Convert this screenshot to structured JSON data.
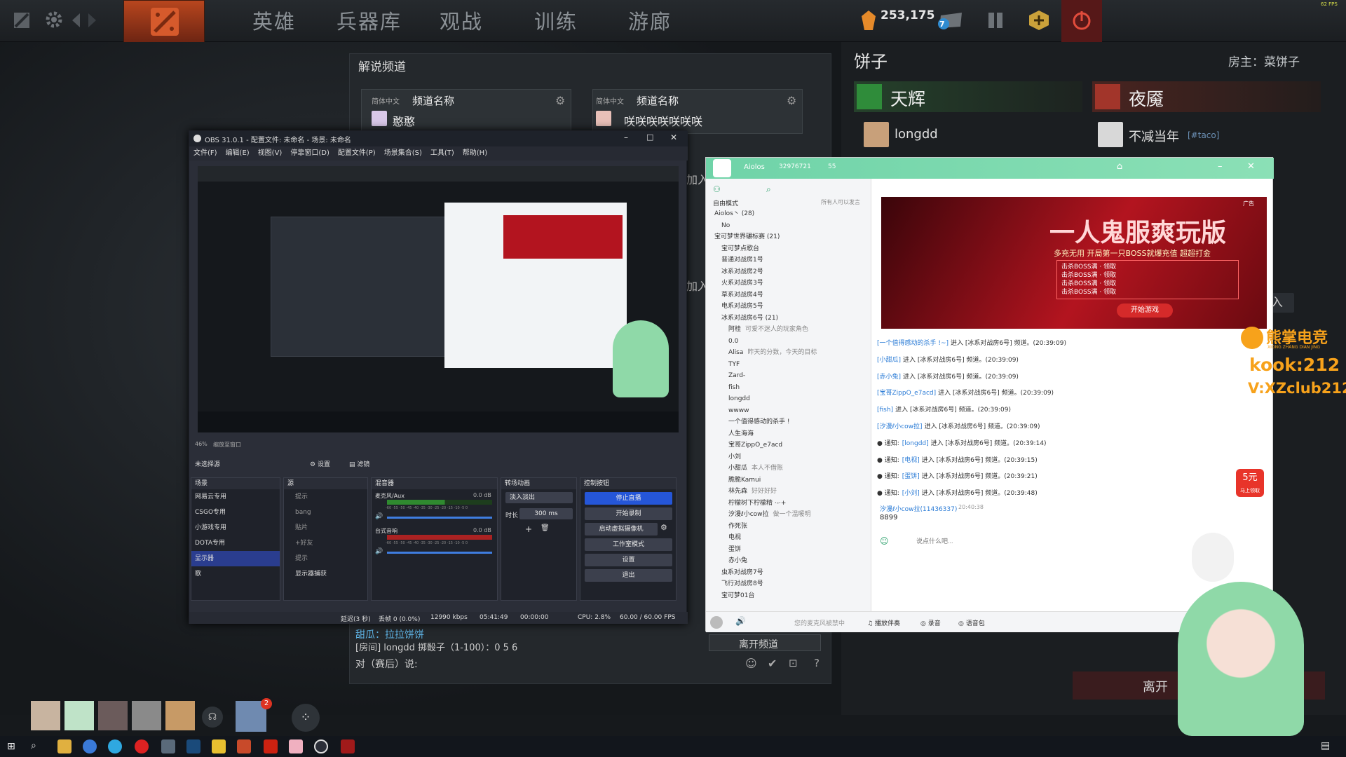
{
  "fps": "62 FPS",
  "dota": {
    "tabs": [
      "英雄",
      "兵器库",
      "观战",
      "训练",
      "游廊"
    ],
    "currency": "253,175",
    "notif_count": "7",
    "friend_badge": "2"
  },
  "commentary": {
    "title": "解说频道",
    "cards": [
      {
        "lang": "简体中文",
        "label": "频道名称",
        "user": "憨憨"
      },
      {
        "lang": "简体中文",
        "label": "频道名称",
        "user": "咲咲咲咲咲咲咲"
      }
    ],
    "join_labels": [
      "加入",
      "加入"
    ],
    "chat_1": "甜瓜：拉拉饼饼",
    "chat_2": "[房间] longdd 掷骰子（1-100）：0 5 6",
    "chat_prompt": "对（赛后）说:",
    "leave": "离开频道",
    "leave_right": "离开"
  },
  "lobby": {
    "name": "饼子",
    "host": "房主：菜饼子",
    "radiant": "天辉",
    "dire": "夜魇",
    "radiant_player": "longdd",
    "dire_player": "不减当年",
    "dire_tag": "[#taco]",
    "join_btn": "加入"
  },
  "obs": {
    "title": "OBS 31.0.1 - 配置文件: 未命名 - 场景: 未命名",
    "menu": [
      "文件(F)",
      "编辑(E)",
      "视图(V)",
      "停靠窗口(D)",
      "配置文件(P)",
      "场景集合(S)",
      "工具(T)",
      "帮助(H)"
    ],
    "zoom": "46%",
    "zoom_mode": "缩放至窗口",
    "no_source": "未选择源",
    "props_btn": "设置",
    "filters_btn": "滤镜",
    "docks": {
      "scenes": "场景",
      "sources": "源",
      "mixer": "混音器",
      "transitions": "转场动画",
      "controls": "控制按钮"
    },
    "scenes": [
      "网易云专用",
      "CSGO专用",
      "小游戏专用",
      "DOTA专用",
      "显示器",
      "歌"
    ],
    "sources": [
      "提示",
      "bang",
      "贴片",
      "+好友",
      "提示",
      "显示器捕获"
    ],
    "mixer": [
      {
        "name": "麦克风/Aux",
        "db": "0.0 dB"
      },
      {
        "name": "台式音响",
        "db": "0.0 dB"
      }
    ],
    "meter_scale": "-60 -55 -50 -45 -40 -35 -30 -25 -20 -15 -10 -5 0",
    "transition": "淡入淡出",
    "duration_label": "时长",
    "duration": "300 ms",
    "controls": [
      "停止直播",
      "开始录制",
      "启动虚拟摄像机",
      "工作室模式",
      "设置",
      "退出"
    ],
    "status": {
      "dropped": "延迟(3 秒)",
      "frames": "丢帧 0 (0.0%)",
      "bitrate": "12990 kbps",
      "live_time": "05:41:49",
      "rec_time": "00:00:00",
      "cpu": "CPU: 2.8%",
      "fps": "60.00 / 60.00 FPS"
    }
  },
  "kook": {
    "server": "Aiolos",
    "id": "32976721",
    "members": "55",
    "mode": "自由模式",
    "mode_right": "所有人可以发言",
    "tree": [
      {
        "t": "Aiolos丶 (28)",
        "lvl": 0
      },
      {
        "t": "No",
        "lvl": 1
      },
      {
        "t": "宝可梦世界碾标赛 (21)",
        "lvl": 0
      },
      {
        "t": "宝可梦点歌台",
        "lvl": 1
      },
      {
        "t": "普通对战房1号",
        "lvl": 1
      },
      {
        "t": "冰系对战房2号",
        "lvl": 1
      },
      {
        "t": "火系对战房3号",
        "lvl": 1
      },
      {
        "t": "草系对战房4号",
        "lvl": 1
      },
      {
        "t": "电系对战房5号",
        "lvl": 1
      },
      {
        "t": "冰系对战房6号 (21)",
        "lvl": 1
      },
      {
        "t": "阿桂",
        "lvl": 2,
        "note": "可爱不迷人的玩家角色"
      },
      {
        "t": "0.0",
        "lvl": 2
      },
      {
        "t": "Alisa",
        "lvl": 2,
        "note": "昨天的分数，今天的目标"
      },
      {
        "t": "TYF",
        "lvl": 2
      },
      {
        "t": "Zard-",
        "lvl": 2
      },
      {
        "t": "fish",
        "lvl": 2
      },
      {
        "t": "longdd",
        "lvl": 2
      },
      {
        "t": "wwww",
        "lvl": 2
      },
      {
        "t": "一个值得感动的杀手 !",
        "lvl": 2
      },
      {
        "t": "人生海海",
        "lvl": 2
      },
      {
        "t": "宝哥ZippO_e7acd",
        "lvl": 2
      },
      {
        "t": "小刘",
        "lvl": 2
      },
      {
        "t": "小甜瓜",
        "lvl": 2,
        "note": "本人不借账"
      },
      {
        "t": "脆脆Kamui",
        "lvl": 2
      },
      {
        "t": "林先森",
        "lvl": 2,
        "note": "好好好好"
      },
      {
        "t": "柠檬树下柠檬精 ·-·+",
        "lvl": 2
      },
      {
        "t": "汐漫ℓ小cow拉",
        "lvl": 2,
        "note": "做一个温暖明"
      },
      {
        "t": "作死张",
        "lvl": 2
      },
      {
        "t": "电视",
        "lvl": 2
      },
      {
        "t": "蛋饼",
        "lvl": 2
      },
      {
        "t": "赤小兔",
        "lvl": 2
      },
      {
        "t": "虫系对战房7号",
        "lvl": 1
      },
      {
        "t": "飞行对战房8号",
        "lvl": 1
      },
      {
        "t": "宝可梦01台",
        "lvl": 1
      }
    ],
    "ad_title": "一人鬼服爽玩版",
    "ad_sub": "多充无用 开局第一只BOSS就爆充值 超超打金",
    "ad_lines": [
      "击杀BOSS满",
      "击杀BOSS满",
      "击杀BOSS满",
      "击杀BOSS满"
    ],
    "ad_claim": "领取",
    "ad_btn": "开始游戏",
    "ad_tag": "广告",
    "messages": [
      {
        "u": "[一个值得感动的杀手 !~]",
        "t": "进入 [冰系对战房6号] 频道。(20:39:09)",
        "notice": false
      },
      {
        "u": "[小甜瓜]",
        "t": "进入 [冰系对战房6号] 频道。(20:39:09)",
        "notice": false
      },
      {
        "u": "[赤小兔]",
        "t": "进入 [冰系对战房6号] 频道。(20:39:09)",
        "notice": false
      },
      {
        "u": "[宝哥ZippO_e7acd]",
        "t": "进入 [冰系对战房6号] 频道。(20:39:09)",
        "notice": false
      },
      {
        "u": "[fish]",
        "t": "进入 [冰系对战房6号] 频道。(20:39:09)",
        "notice": false
      },
      {
        "u": "[汐漫ℓ小cow拉]",
        "t": "进入 [冰系对战房6号] 频道。(20:39:09)",
        "notice": false
      },
      {
        "u": "[longdd]",
        "t": "进入 [冰系对战房6号] 频道。(20:39:14)",
        "notice": true
      },
      {
        "u": "[电视]",
        "t": "进入 [冰系对战房6号] 频道。(20:39:15)",
        "notice": true
      },
      {
        "u": "[蛋饼]",
        "t": "进入 [冰系对战房6号] 频道。(20:39:21)",
        "notice": true
      },
      {
        "u": "[小刘]",
        "t": "进入 [冰系对战房6号] 频道。(20:39:48)",
        "notice": true
      }
    ],
    "notice_label": "通知:",
    "last_user": "汐漫ℓ小cow拉(11436337)",
    "last_time": "20:40:38",
    "last_text": "8899",
    "input_ph": "说点什么吧...",
    "bottom": {
      "mic": "您的麦克风被禁中",
      "music": "播放伴奏",
      "record": "录音",
      "voice": "语音包"
    },
    "promo": "5元",
    "promo_sub": "马上领取"
  },
  "overlay": {
    "brand": "熊掌电竞",
    "brand_sub": "XIONG ZHANG DIAN JING",
    "kook": "kook:212",
    "vx": "V:XZclub212"
  },
  "colors": {
    "obs_stop": "#2556d8",
    "kook_green": "#6fd3a8",
    "ad_red": "#c1121f",
    "brand_orange": "#f7a21b"
  }
}
